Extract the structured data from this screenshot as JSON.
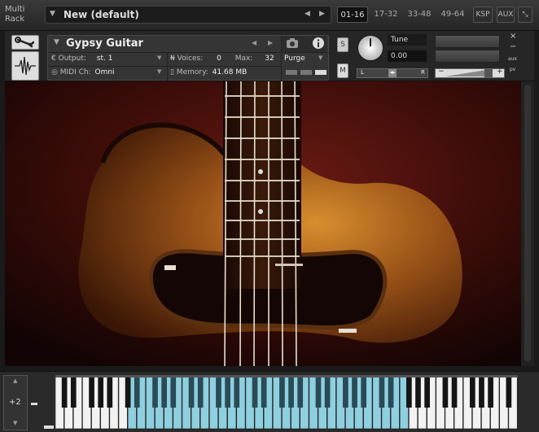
{
  "rack": {
    "title_line1": "Multi",
    "title_line2": "Rack",
    "preset_name": "New (default)",
    "page_tabs": [
      "01-16",
      "17-32",
      "33-48",
      "49-64"
    ],
    "active_tab": "01-16",
    "ksp_label": "KSP",
    "aux_label": "AUX"
  },
  "instrument": {
    "name": "Gypsy Guitar",
    "output_label": "Output:",
    "output_value": "st. 1",
    "voices_label": "Voices:",
    "voices_value": "0",
    "max_label": "Max:",
    "max_value": "32",
    "purge_label": "Purge",
    "midi_label": "MIDI Ch:",
    "midi_value": "Omni",
    "memory_label": "Memory:",
    "memory_value": "41.68 MB",
    "solo_label": "S",
    "mute_label": "M",
    "tune_label": "Tune",
    "tune_value": "0.00",
    "pan_left": "L",
    "pan_right": "R",
    "vol_minus": "−",
    "vol_plus": "+",
    "close_label": "×",
    "min_label": "−",
    "aux_label": "aux",
    "pv_label": "pv"
  },
  "keyboard": {
    "octave_value": "+2"
  },
  "colors": {
    "accent_key": "#8ecfe0",
    "background": "#1a1a1a"
  }
}
